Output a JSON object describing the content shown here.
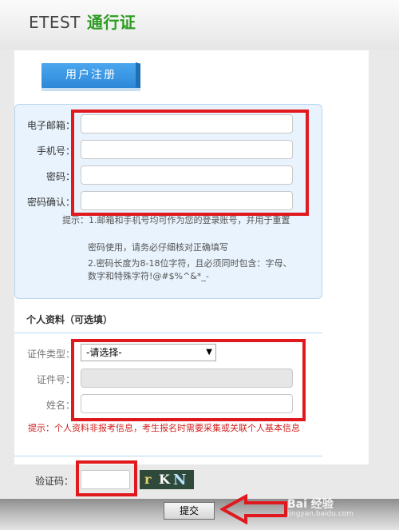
{
  "header": {
    "brand_text": "ETEST",
    "brand_pass": "通行证"
  },
  "tab": {
    "label": "用户注册"
  },
  "account": {
    "email_label": "电子邮箱：",
    "phone_label": "手机号：",
    "password_label": "密码：",
    "confirm_label": "密码确认：",
    "hint_line1": "提示：1.邮箱和手机号均可作为您的登录账号，并用于重置",
    "hint_line2": "密码使用，请务必仔细核对正确填写",
    "hint_line3": "2.密码长度为8-18位字符，且必须同时包含：字母、数字和特殊字符!@#$%^&*_-"
  },
  "profile": {
    "section_title": "个人资料（可选填）",
    "id_type_label": "证件类型：",
    "id_type_value": "-请选择-",
    "id_number_label": "证件号：",
    "name_label": "姓名：",
    "note": "提示：个人资料非报考信息，考生报名时需要采集或关联个人基本信息"
  },
  "captcha": {
    "label": "验证码：",
    "chars": [
      "r",
      "K",
      "N"
    ]
  },
  "submit_label": "提交",
  "watermark": {
    "text": "Bai 经验",
    "sub": "jingyan.baidu.com"
  },
  "colors": {
    "annotation_red": "#e0191f",
    "brand_green": "#2e9b22",
    "tab_blue": "#3b98e6"
  }
}
